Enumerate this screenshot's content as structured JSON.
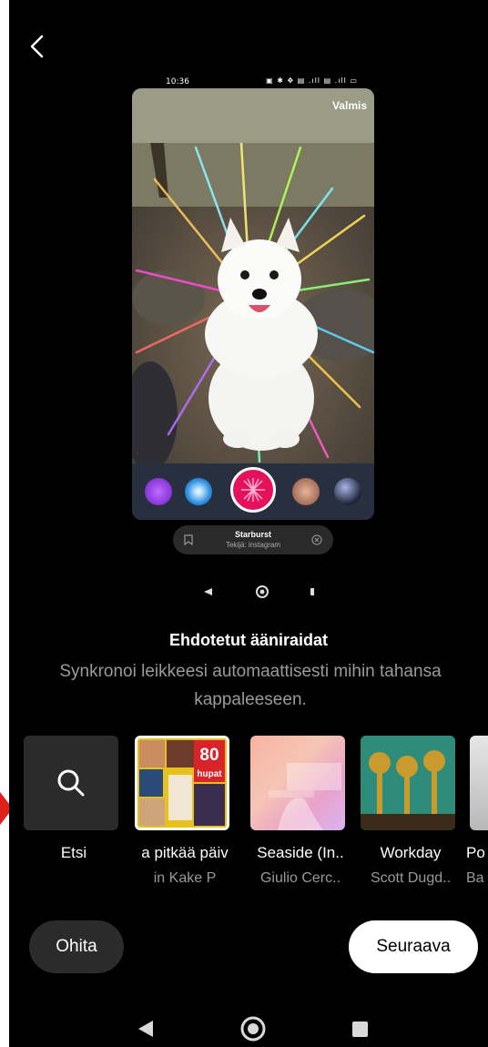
{
  "preview": {
    "status_time": "10:36",
    "status_icons": "▣ ✱ ✥ ▤ .ıll ▤ .ıll ▭",
    "done_label": "Valmis",
    "filter_name": "Starburst",
    "filter_by": "Tekijä: instagram"
  },
  "heading": "Ehdotetut ääniraidat",
  "subtitle": "Synkronoi leikkeesi automaattisesti mihin tahansa kappaleeseen.",
  "tracks": [
    {
      "title": "Etsi",
      "artist": ""
    },
    {
      "title": "a pitkää päiv",
      "artist": "in    Kake P"
    },
    {
      "title": "Seaside (In..",
      "artist": "Giulio Cerc.."
    },
    {
      "title": "Workday",
      "artist": "Scott Dugd.."
    },
    {
      "title": "Po",
      "artist": "Ba"
    }
  ],
  "album_text": {
    "big": "80",
    "small": "hupat"
  },
  "buttons": {
    "skip": "Ohita",
    "next": "Seuraava"
  },
  "colors": {
    "background": "#000000",
    "accent_red": "#e0201a",
    "effect_pink": "#e5115a"
  }
}
